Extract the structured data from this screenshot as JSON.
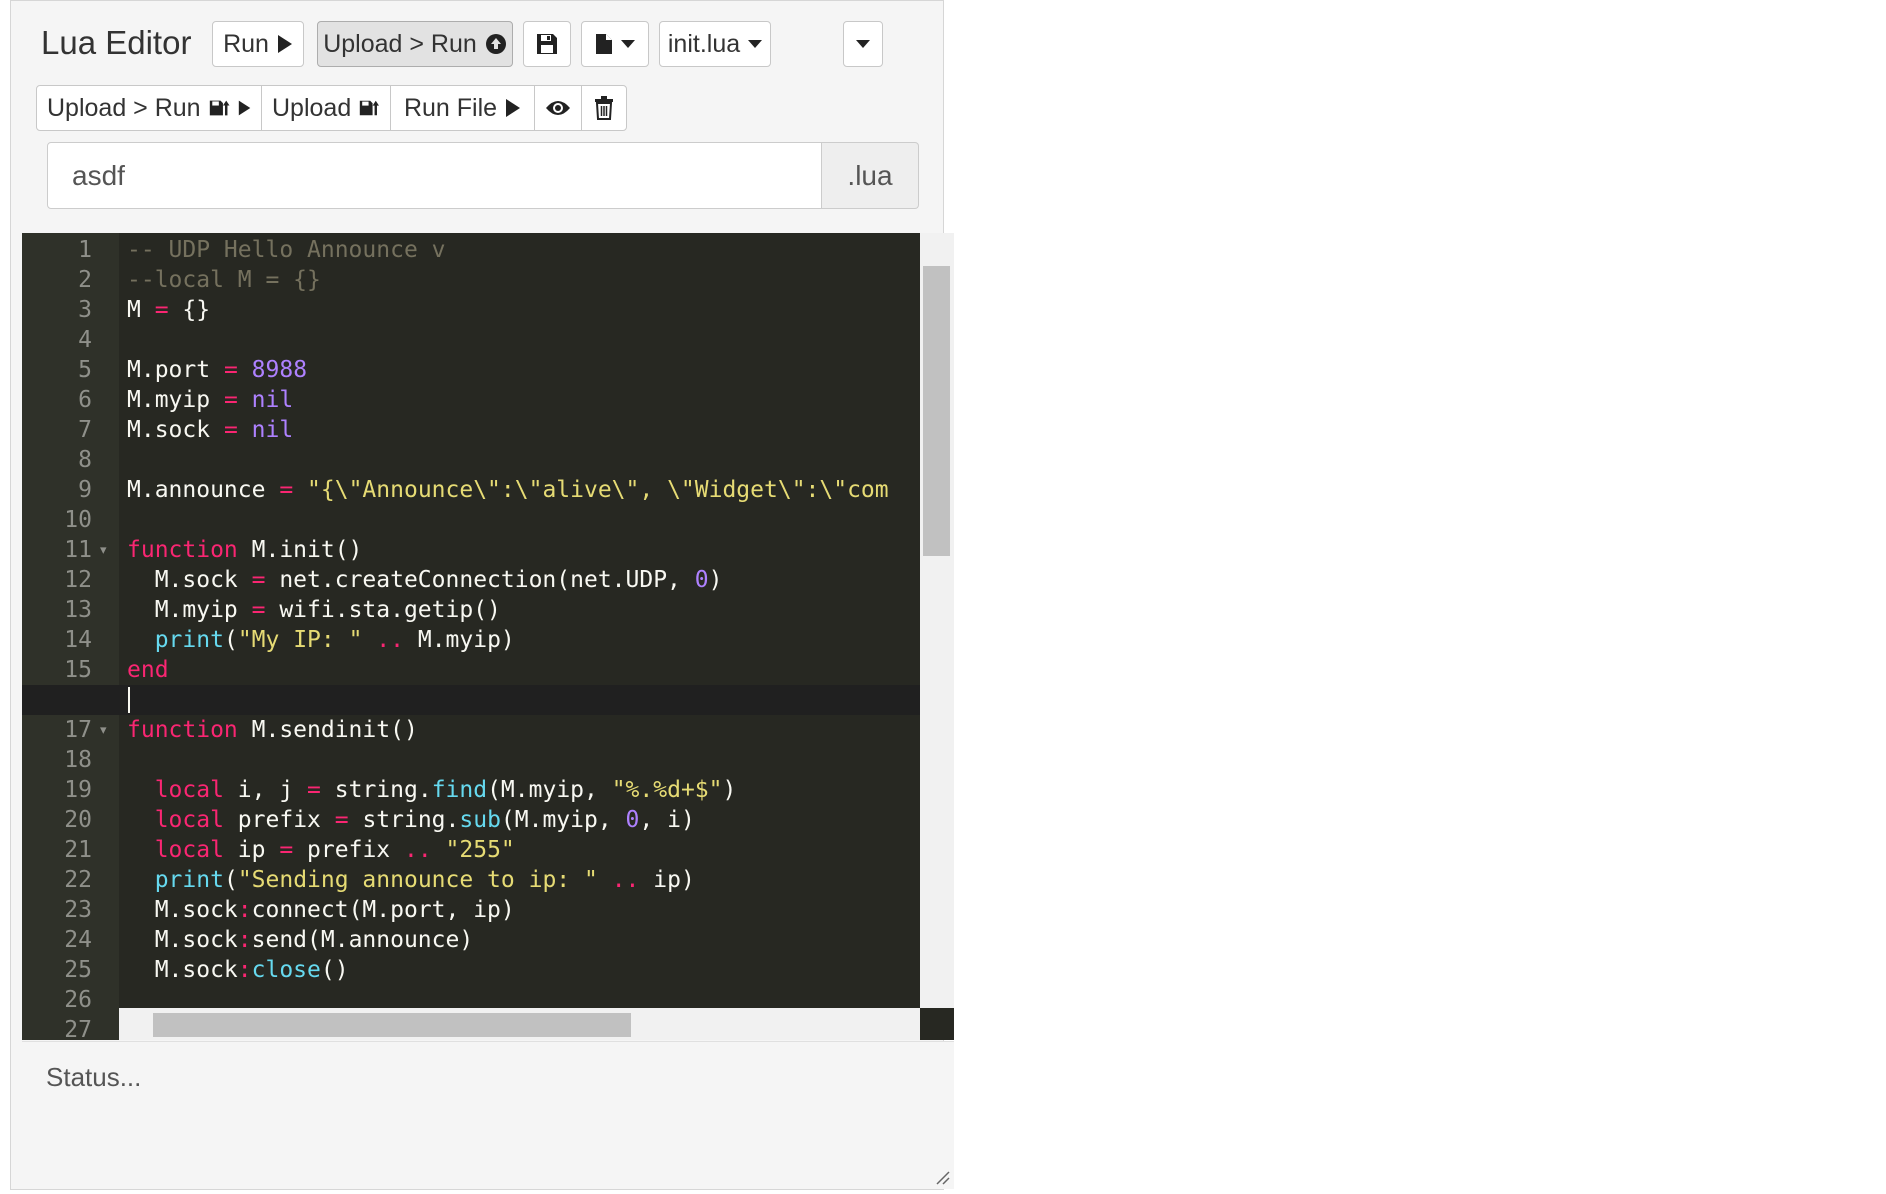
{
  "app": {
    "title": "Lua Editor"
  },
  "toolbar": {
    "run_label": "Run",
    "upload_run_label": "Upload > Run",
    "file_select": "init.lua",
    "upload_run_save_label": "Upload > Run",
    "upload_label": "Upload",
    "run_file_label": "Run File"
  },
  "filename": {
    "value": "asdf",
    "extension": ".lua"
  },
  "editor": {
    "theme": {
      "background": "#272822",
      "comment": "#75715e",
      "keyword": "#f92672",
      "number": "#ae81ff",
      "string": "#e6db74",
      "builtin": "#66d9ef",
      "text": "#f8f8f2"
    },
    "active_line": 16,
    "line_numbers": [
      "1",
      "2",
      "3",
      "4",
      "5",
      "6",
      "7",
      "8",
      "9",
      "10",
      "11",
      "12",
      "13",
      "14",
      "15",
      "16",
      "17",
      "18",
      "19",
      "20",
      "21",
      "22",
      "23",
      "24",
      "25",
      "26",
      "27"
    ],
    "folds": [
      11,
      17
    ],
    "lines": [
      [
        [
          "cm",
          "-- UDP Hello Announce v"
        ]
      ],
      [
        [
          "cm",
          "--local M = {}"
        ]
      ],
      [
        [
          "",
          "M "
        ],
        [
          "op",
          "="
        ],
        [
          "",
          "",
          " {}"
        ]
      ],
      [],
      [
        [
          "",
          "M.port "
        ],
        [
          "op",
          "="
        ],
        [
          "",
          " "
        ],
        [
          "num",
          "8988"
        ]
      ],
      [
        [
          "",
          "M.myip "
        ],
        [
          "op",
          "="
        ],
        [
          "",
          " "
        ],
        [
          "num",
          "nil"
        ]
      ],
      [
        [
          "",
          "M.sock "
        ],
        [
          "op",
          "="
        ],
        [
          "",
          " "
        ],
        [
          "num",
          "nil"
        ]
      ],
      [],
      [
        [
          "",
          "M.announce "
        ],
        [
          "op",
          "="
        ],
        [
          "",
          " "
        ],
        [
          "str",
          "\"{\\\"Announce\\\":\\\"alive\\\", \\\"Widget\\\":\\\"com"
        ]
      ],
      [],
      [
        [
          "kw",
          "function"
        ],
        [
          "",
          " M.init()"
        ]
      ],
      [
        [
          "",
          "  M.sock "
        ],
        [
          "op",
          "="
        ],
        [
          "",
          " net.createConnection(net.UDP, "
        ],
        [
          "num",
          "0"
        ],
        [
          "",
          ")"
        ]
      ],
      [
        [
          "",
          "  M.myip "
        ],
        [
          "op",
          "="
        ],
        [
          "",
          " wifi.sta.getip()"
        ]
      ],
      [
        [
          "",
          "  "
        ],
        [
          "fn",
          "print"
        ],
        [
          "",
          "("
        ],
        [
          "str",
          "\"My IP: \""
        ],
        [
          "",
          " "
        ],
        [
          "op",
          ".."
        ],
        [
          "",
          " M.myip)"
        ]
      ],
      [
        [
          "kw",
          "end"
        ]
      ],
      [],
      [
        [
          "kw",
          "function"
        ],
        [
          "",
          " M.sendinit()"
        ]
      ],
      [],
      [
        [
          "",
          "  "
        ],
        [
          "kw",
          "local"
        ],
        [
          "",
          " i, j "
        ],
        [
          "op",
          "="
        ],
        [
          "",
          " string."
        ],
        [
          "fn",
          "find"
        ],
        [
          "",
          "(M.myip, "
        ],
        [
          "str",
          "\"%.%d+$\""
        ],
        [
          "",
          ")"
        ]
      ],
      [
        [
          "",
          "  "
        ],
        [
          "kw",
          "local"
        ],
        [
          "",
          " prefix "
        ],
        [
          "op",
          "="
        ],
        [
          "",
          " string."
        ],
        [
          "fn",
          "sub"
        ],
        [
          "",
          "(M.myip, "
        ],
        [
          "num",
          "0"
        ],
        [
          "",
          ", i)"
        ]
      ],
      [
        [
          "",
          "  "
        ],
        [
          "kw",
          "local"
        ],
        [
          "",
          " ip "
        ],
        [
          "op",
          "="
        ],
        [
          "",
          " prefix "
        ],
        [
          "op",
          ".."
        ],
        [
          "",
          " "
        ],
        [
          "str",
          "\"255\""
        ]
      ],
      [
        [
          "",
          "  "
        ],
        [
          "fn",
          "print"
        ],
        [
          "",
          "("
        ],
        [
          "str",
          "\"Sending announce to ip: \""
        ],
        [
          "",
          " "
        ],
        [
          "op",
          ".."
        ],
        [
          "",
          " ip)"
        ]
      ],
      [
        [
          "",
          "  M.sock"
        ],
        [
          "op",
          ":"
        ],
        [
          "",
          "connect(M.port, ip)"
        ]
      ],
      [
        [
          "",
          "  M.sock"
        ],
        [
          "op",
          ":"
        ],
        [
          "",
          "send(M.announce)"
        ]
      ],
      [
        [
          "",
          "  M.sock"
        ],
        [
          "op",
          ":"
        ],
        [
          "fn",
          "close"
        ],
        [
          "",
          "()"
        ]
      ],
      [],
      []
    ]
  },
  "status": {
    "text": "Status..."
  },
  "icons": {
    "run": "play-icon",
    "upload_run": "upload-circle-icon",
    "save": "floppy-icon",
    "file_menu": "file-icon",
    "view": "eye-icon",
    "delete": "trash-icon"
  }
}
